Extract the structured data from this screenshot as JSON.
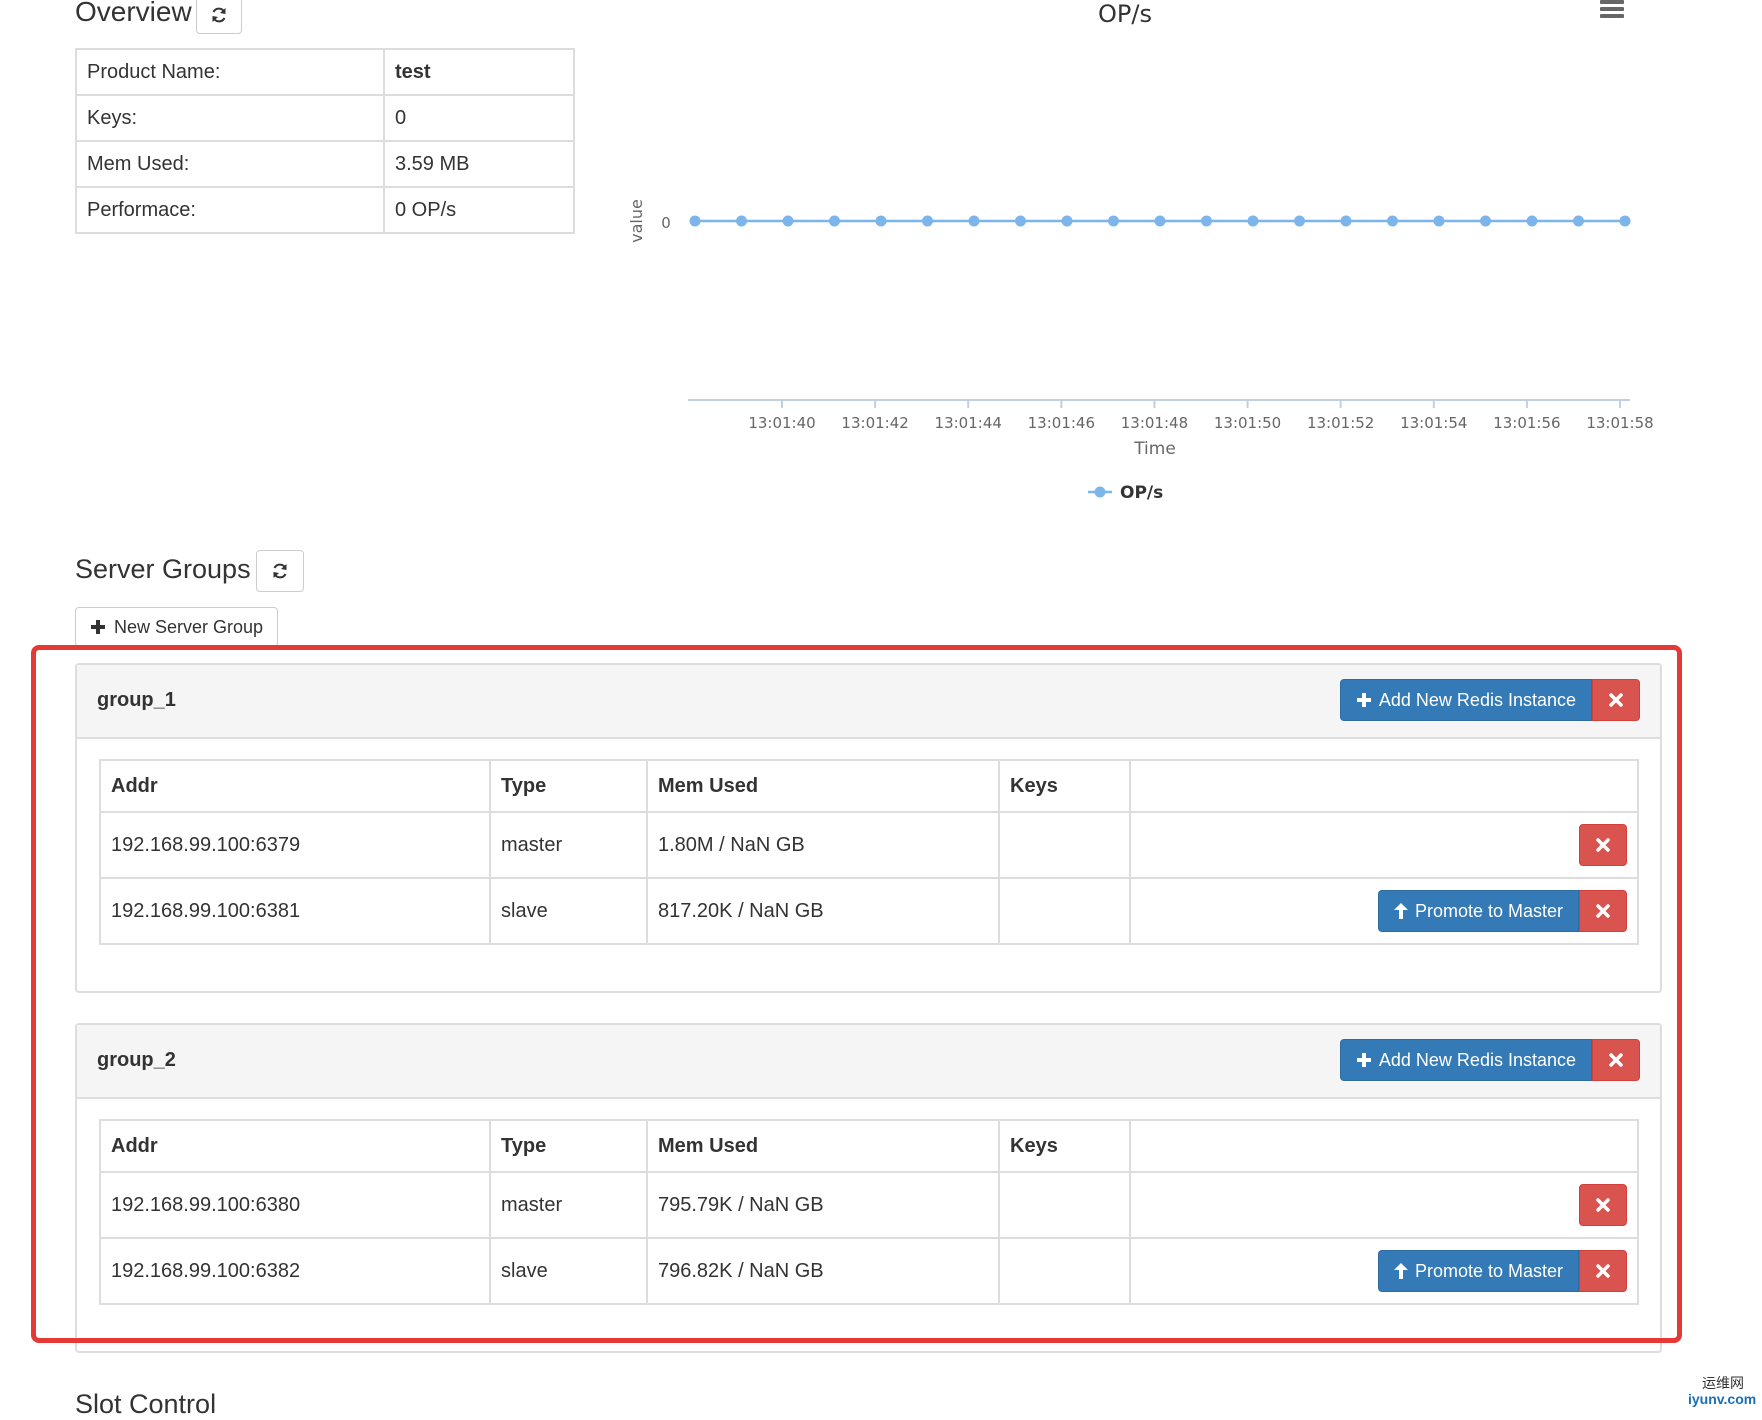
{
  "overview": {
    "title": "Overview",
    "refresh_icon": "refresh-icon",
    "rows": [
      {
        "label": "Product Name:",
        "value": "test"
      },
      {
        "label": "Keys:",
        "value": "0"
      },
      {
        "label": "Mem Used:",
        "value": "3.59 MB"
      },
      {
        "label": "Performace:",
        "value": "0 OP/s"
      }
    ]
  },
  "chart_data": {
    "type": "line",
    "title": "OP/s",
    "xlabel": "Time",
    "ylabel": "value",
    "y_ticks": [
      "0"
    ],
    "x_ticks": [
      "13:01:40",
      "13:01:42",
      "13:01:44",
      "13:01:46",
      "13:01:48",
      "13:01:50",
      "13:01:52",
      "13:01:54",
      "13:01:56",
      "13:01:58"
    ],
    "series": [
      {
        "name": "OP/s",
        "color": "#7cb5ec",
        "values": [
          0,
          0,
          0,
          0,
          0,
          0,
          0,
          0,
          0,
          0,
          0,
          0,
          0,
          0,
          0,
          0,
          0,
          0,
          0,
          0,
          0
        ]
      }
    ],
    "legend": "bottom-center",
    "menu_icon": "hamburger-menu-icon"
  },
  "server_groups": {
    "title": "Server Groups",
    "new_group_label": "New Server Group",
    "columns": [
      "Addr",
      "Type",
      "Mem Used",
      "Keys",
      ""
    ],
    "add_instance_label": "Add New Redis Instance",
    "promote_label": "Promote to Master",
    "groups": [
      {
        "name": "group_1",
        "servers": [
          {
            "addr": "192.168.99.100:6379",
            "type": "master",
            "mem": "1.80M / NaN GB",
            "keys": ""
          },
          {
            "addr": "192.168.99.100:6381",
            "type": "slave",
            "mem": "817.20K / NaN GB",
            "keys": ""
          }
        ]
      },
      {
        "name": "group_2",
        "servers": [
          {
            "addr": "192.168.99.100:6380",
            "type": "master",
            "mem": "795.79K / NaN GB",
            "keys": ""
          },
          {
            "addr": "192.168.99.100:6382",
            "type": "slave",
            "mem": "796.82K / NaN GB",
            "keys": ""
          }
        ]
      }
    ]
  },
  "slot_control": {
    "title": "Slot Control"
  },
  "watermark": {
    "line1": "运维网",
    "line2": "iyunv.com"
  },
  "colors": {
    "primary": "#337ab7",
    "danger": "#d9534f",
    "highlight_frame": "#e53935",
    "series": "#7cb5ec"
  }
}
